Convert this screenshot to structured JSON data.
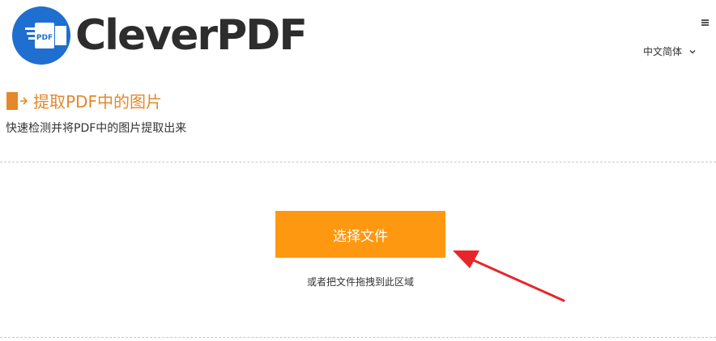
{
  "brand": {
    "name": "CleverPDF",
    "mark_text": "PDF",
    "color_blue": "#1e6fd0",
    "color_dark": "#2d2d2d"
  },
  "header": {
    "language_label": "中文简体",
    "menu_icon": "hamburger-icon",
    "chevron_icon": "chevron-down-icon"
  },
  "tool": {
    "icon": "extract-file-icon",
    "title": "提取PDF中的图片",
    "subtitle": "快速检测并将PDF中的图片提取出来",
    "accent_color": "#e4882a"
  },
  "upload": {
    "button_label": "选择文件",
    "button_color": "#ff9811",
    "drop_hint": "或者把文件拖拽到此区域"
  },
  "annotation": {
    "arrow_color": "#e8252a"
  }
}
